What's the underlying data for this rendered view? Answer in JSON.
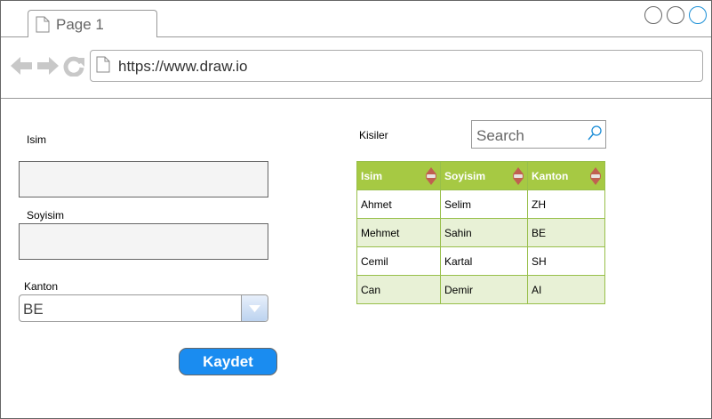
{
  "browser": {
    "tab_label": "Page 1",
    "url": "https://www.draw.io"
  },
  "form": {
    "name_label": "Isim",
    "surname_label": "Soyisim",
    "canton_label": "Kanton",
    "canton_value": "BE",
    "save_label": "Kaydet"
  },
  "people": {
    "title": "Kisiler",
    "search_placeholder": "Search",
    "columns": [
      "Isim",
      "Soyisim",
      "Kanton"
    ],
    "rows": [
      [
        "Ahmet",
        "Selim",
        "ZH"
      ],
      [
        "Mehmet",
        "Sahin",
        "BE"
      ],
      [
        "Cemil",
        "Kartal",
        "SH"
      ],
      [
        "Can",
        "Demir",
        "AI"
      ]
    ]
  },
  "colors": {
    "accent_button": "#1a8cf0",
    "table_header": "#a6c943",
    "table_alt_row": "#e8f1d6"
  }
}
